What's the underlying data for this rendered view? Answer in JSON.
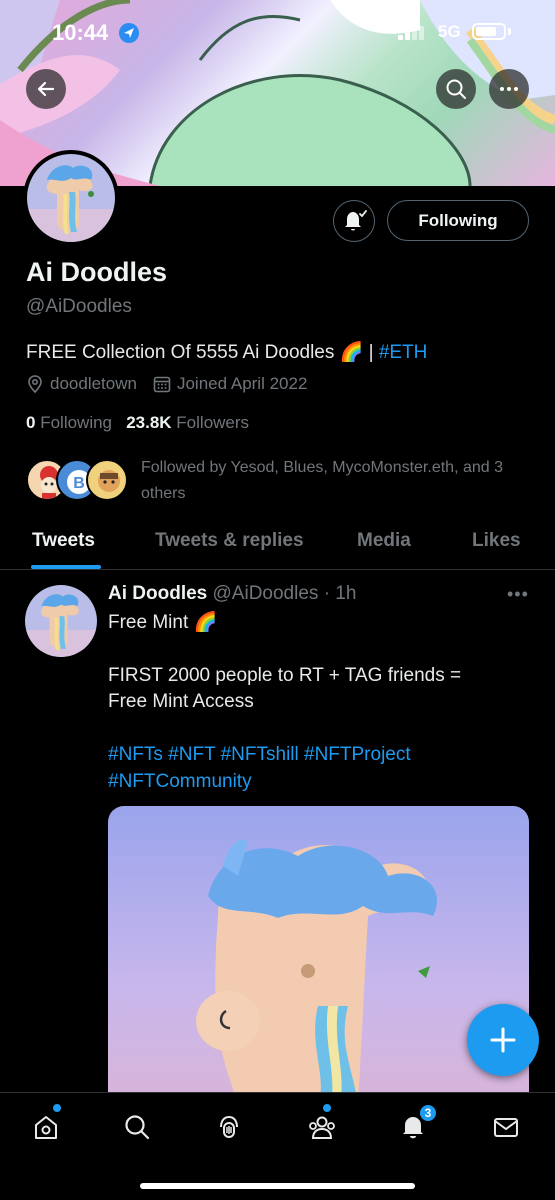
{
  "status_bar": {
    "time": "10:44",
    "network": "5G"
  },
  "profile": {
    "name": "Ai Doodles",
    "handle": "@AiDoodles",
    "bio_text": "FREE Collection Of 5555 Ai Doodles 🌈 | ",
    "bio_link": "#ETH",
    "location": "doodletown",
    "joined": "Joined April 2022",
    "following_count": "0",
    "following_label": "Following",
    "followers_count": "23.8K",
    "followers_label": "Followers",
    "followed_by": "Followed by Yesod, Blues, MycoMonster.eth, and 3 others",
    "follow_button": "Following"
  },
  "tabs": [
    {
      "label": "Tweets"
    },
    {
      "label": "Tweets & replies"
    },
    {
      "label": "Media"
    },
    {
      "label": "Likes"
    }
  ],
  "tweet": {
    "author": "Ai Doodles",
    "handle": "@AiDoodles",
    "time": "· 1h",
    "line1": "Free Mint 🌈",
    "line2": "FIRST 2000 people to RT + TAG friends =",
    "line3": "Free Mint Access",
    "hashtags1": "#NFTs #NFT #NFTshill #NFTProject",
    "hashtags2": "#NFTCommunity"
  },
  "notifications_badge": "3",
  "colors": {
    "accent": "#1d9bf0",
    "background": "#000000",
    "muted": "#71767b"
  }
}
